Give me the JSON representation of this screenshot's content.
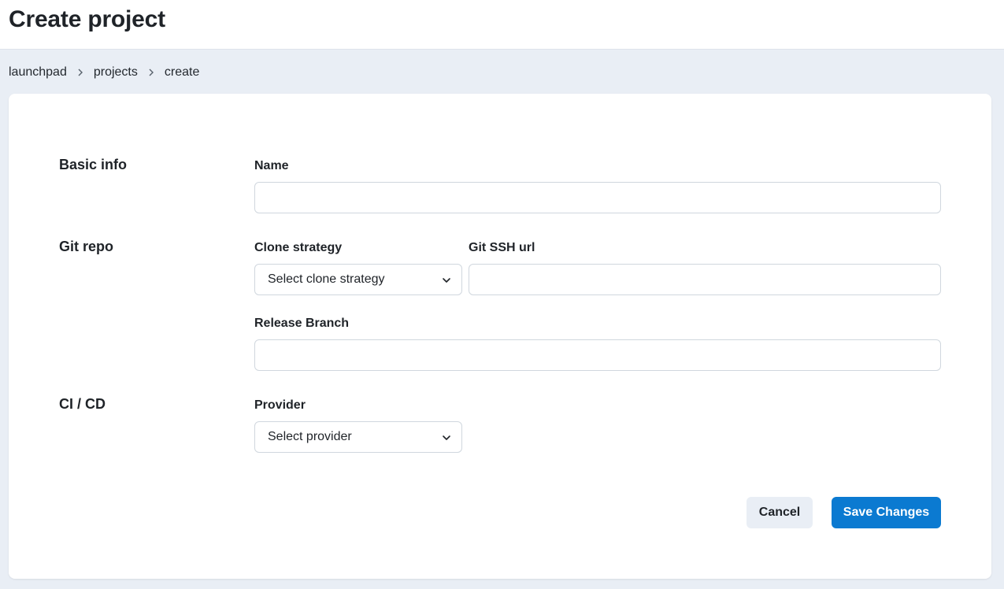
{
  "header": {
    "title": "Create project"
  },
  "breadcrumb": {
    "items": [
      "launchpad",
      "projects",
      "create"
    ]
  },
  "form": {
    "basic_info": {
      "section_title": "Basic info",
      "name_label": "Name",
      "name_value": ""
    },
    "git_repo": {
      "section_title": "Git repo",
      "clone_strategy_label": "Clone strategy",
      "clone_strategy_value": "Select clone strategy",
      "ssh_url_label": "Git SSH url",
      "ssh_url_value": "",
      "release_branch_label": "Release Branch",
      "release_branch_value": ""
    },
    "ci_cd": {
      "section_title": "CI / CD",
      "provider_label": "Provider",
      "provider_value": "Select provider"
    }
  },
  "actions": {
    "cancel_label": "Cancel",
    "save_label": "Save Changes"
  },
  "colors": {
    "page_background": "#e9eef5",
    "primary": "#0b7ad1",
    "border": "#d0d7de"
  }
}
